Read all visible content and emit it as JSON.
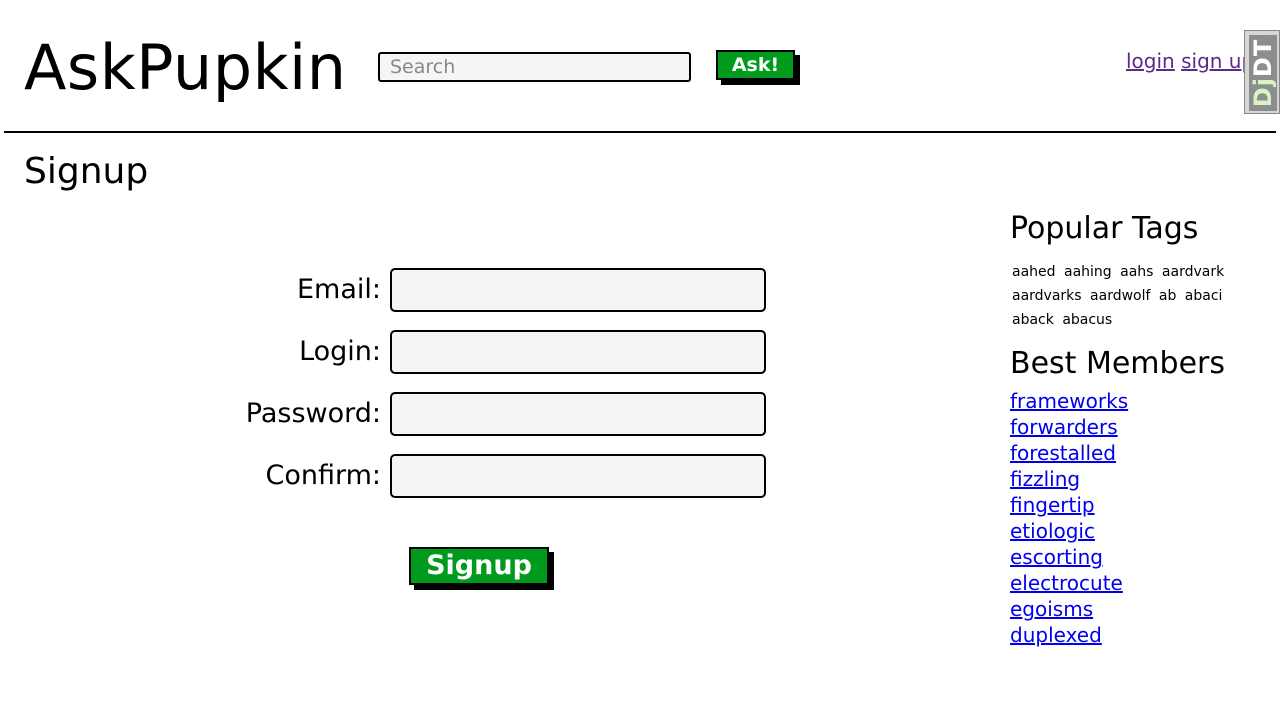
{
  "header": {
    "logo": "AskPupkin",
    "search_placeholder": "Search",
    "ask_label": "Ask!",
    "login_label": "login",
    "signup_label": "sign up"
  },
  "debug_toolbar": {
    "label_dj": "Dj",
    "label_dt": "DT"
  },
  "page": {
    "title": "Signup"
  },
  "form": {
    "fields": [
      {
        "label": "Email:",
        "value": ""
      },
      {
        "label": "Login:",
        "value": ""
      },
      {
        "label": "Password:",
        "value": ""
      },
      {
        "label": "Confirm:",
        "value": ""
      }
    ],
    "submit_label": "Signup"
  },
  "sidebar": {
    "tags_title": "Popular Tags",
    "tags": [
      "aahed",
      "aahing",
      "aahs",
      "aardvark",
      "aardvarks",
      "aardwolf",
      "ab",
      "abaci",
      "aback",
      "abacus"
    ],
    "members_title": "Best Members",
    "members": [
      "frameworks",
      "forwarders",
      "forestalled",
      "fizzling",
      "fingertip",
      "etiologic",
      "escorting",
      "electrocute",
      "egoisms",
      "duplexed"
    ]
  },
  "colors": {
    "button_green": "#009a1c",
    "link_blue": "#0000ee",
    "visited_link": "#5b2a8c",
    "input_bg": "#f5f5f5"
  }
}
